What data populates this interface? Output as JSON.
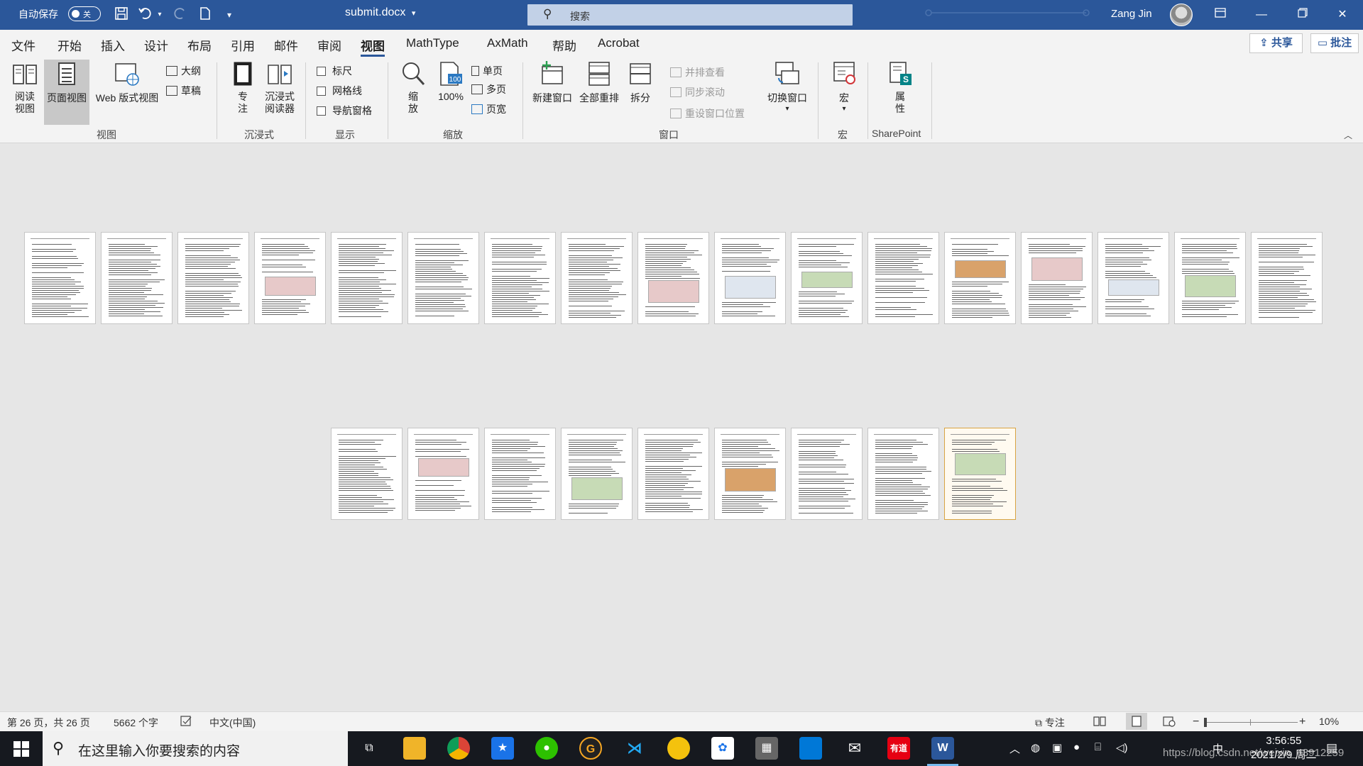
{
  "titlebar": {
    "autosave_label": "自动保存",
    "autosave_state": "关",
    "doc_title": "submit.docx",
    "search_placeholder": "搜索",
    "user_name": "Zang Jin"
  },
  "menu": {
    "tabs": [
      "文件",
      "开始",
      "插入",
      "设计",
      "布局",
      "引用",
      "邮件",
      "审阅",
      "视图",
      "MathType",
      "AxMath",
      "帮助",
      "Acrobat"
    ],
    "active_tab": "视图",
    "share_label": "共享",
    "comment_label": "批注"
  },
  "ribbon": {
    "views": {
      "read_mode": "阅读视图",
      "print_layout": "页面视图",
      "web_layout": "Web 版式视图",
      "outline": "大纲",
      "draft": "草稿",
      "group_label": "视图"
    },
    "immersive": {
      "focus": "专注",
      "immersive_reader": "沉浸式阅读器",
      "group_label": "沉浸式"
    },
    "show": {
      "ruler": "标尺",
      "gridlines": "网格线",
      "nav_pane": "导航窗格",
      "group_label": "显示"
    },
    "zoom": {
      "zoom": "缩放",
      "hundred": "100%",
      "one_page": "单页",
      "multi_page": "多页",
      "page_width": "页宽",
      "group_label": "缩放"
    },
    "window": {
      "new_window": "新建窗口",
      "arrange_all": "全部重排",
      "split": "拆分",
      "side_by_side": "并排查看",
      "sync_scroll": "同步滚动",
      "reset_position": "重设窗口位置",
      "switch_windows": "切换窗口",
      "group_label": "窗口"
    },
    "macros": {
      "macros": "宏",
      "group_label": "宏"
    },
    "sharepoint": {
      "properties": "属性",
      "group_label": "SharePoint"
    }
  },
  "document": {
    "page_count": 26,
    "row1_count": 17,
    "row2_count": 9
  },
  "status": {
    "page_info": "第 26 页，共 26 页",
    "word_count": "5662 个字",
    "language": "中文(中国)",
    "focus": "专注",
    "zoom": "10%",
    "zoom_level": 0.1
  },
  "taskbar": {
    "search_placeholder": "在这里输入你要搜索的内容",
    "time": "3:56:55",
    "date": "2021/2/9 周二",
    "ime": "中",
    "watermark": "https://blog.csdn.net/weixin_43912259"
  },
  "colors": {
    "word_blue": "#2b579a",
    "ribbon_bg": "#f3f3f3",
    "canvas_bg": "#e6e6e6",
    "taskbar_bg": "#16191f"
  }
}
